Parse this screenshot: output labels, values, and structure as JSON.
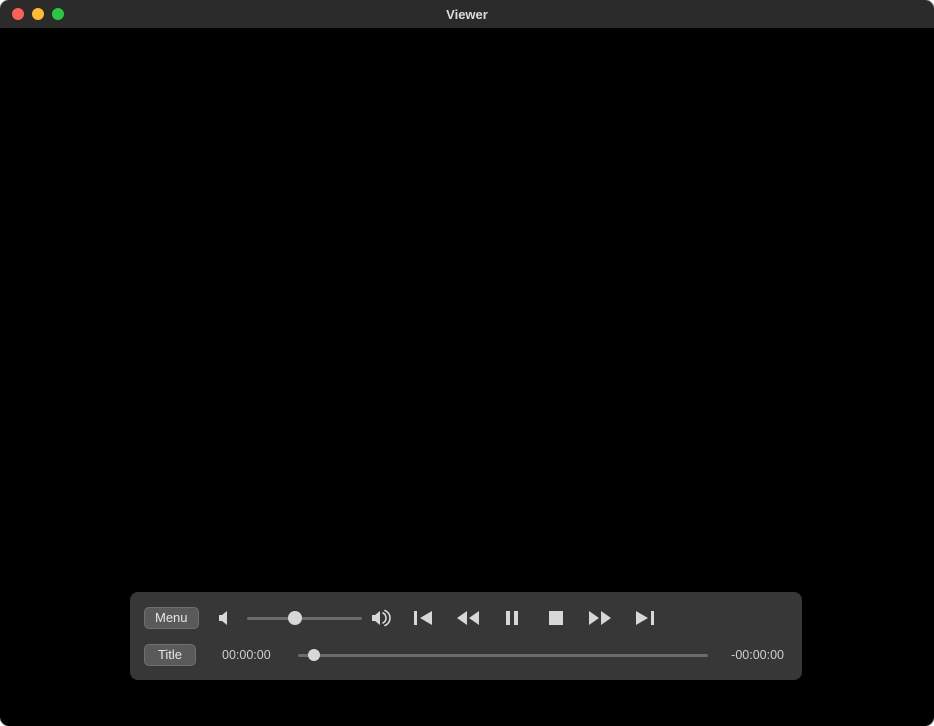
{
  "window": {
    "title": "Viewer"
  },
  "controller": {
    "menu_label": "Menu",
    "title_label": "Title",
    "volume_percent": 42,
    "time_elapsed": "00:00:00",
    "time_remaining": "-00:00:00",
    "scrub_percent": 4
  }
}
